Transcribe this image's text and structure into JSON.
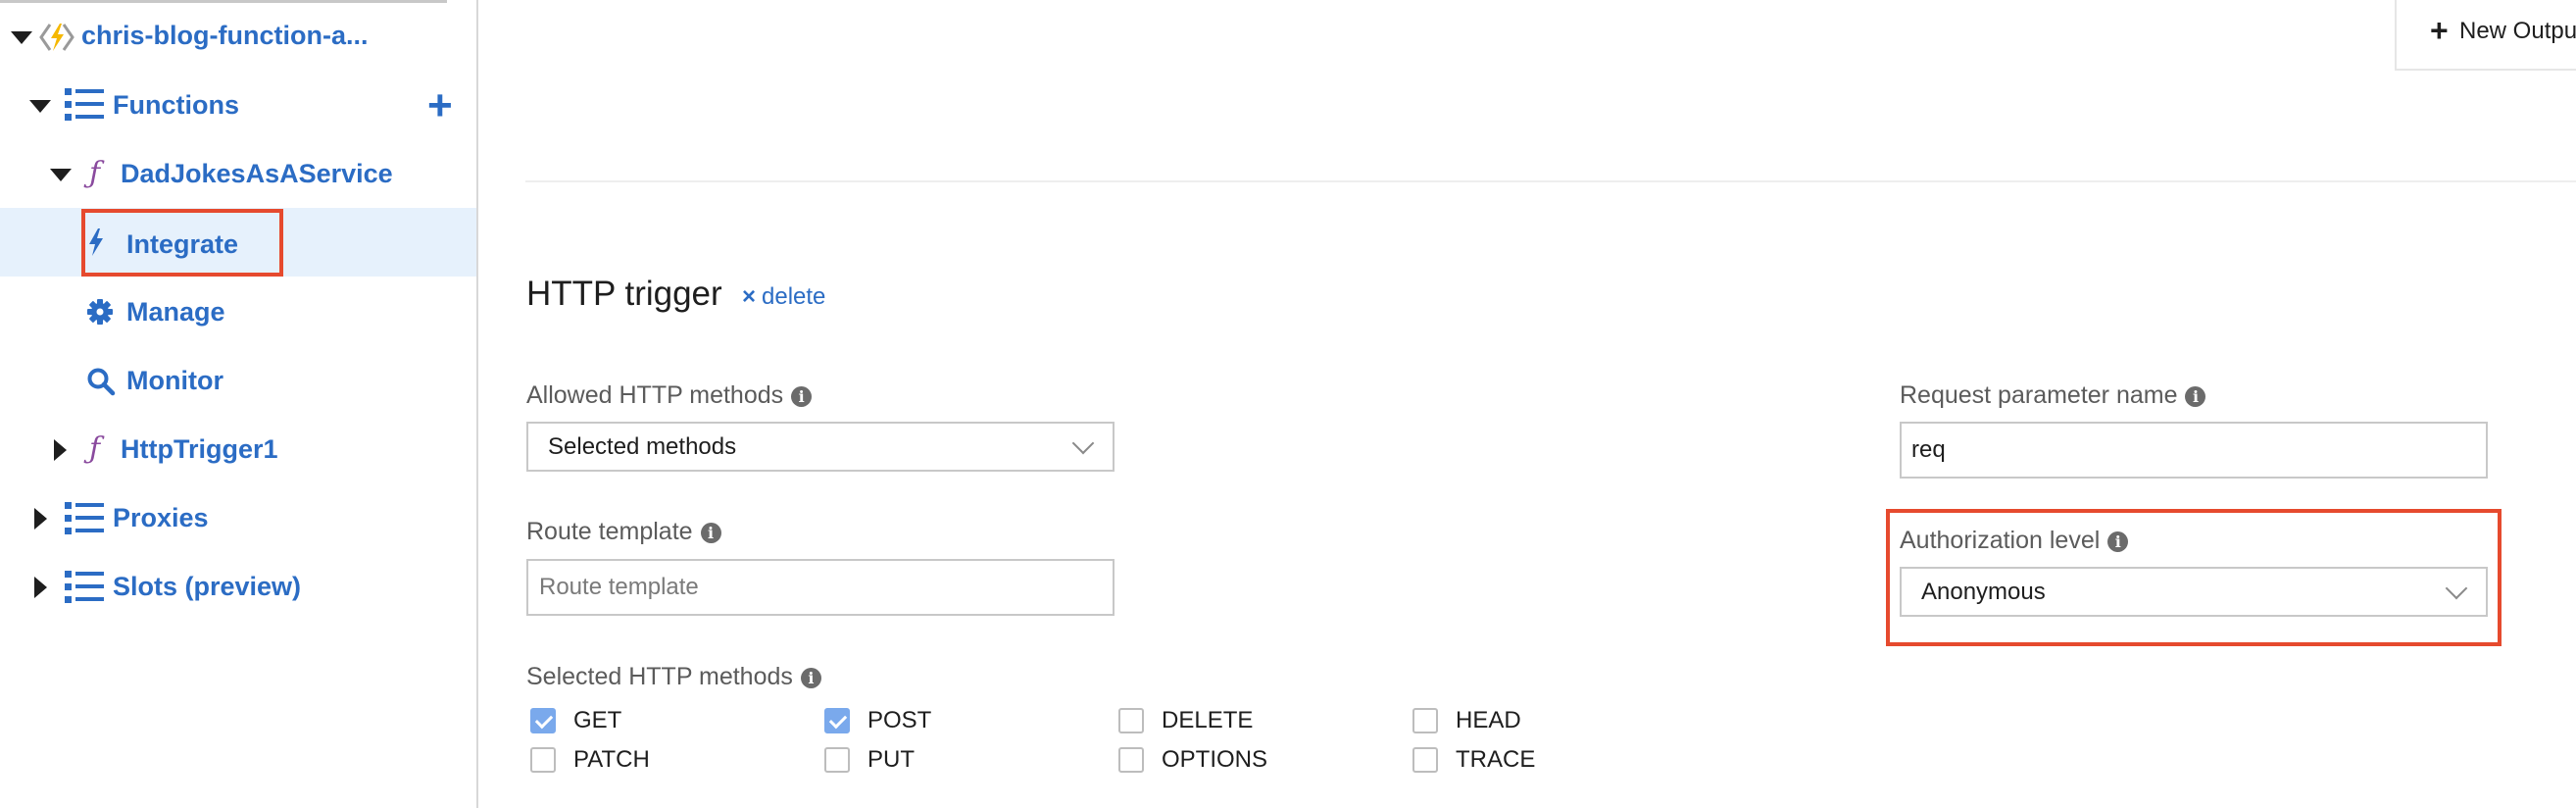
{
  "sidebar": {
    "app_name": "chris-blog-function-a...",
    "functions_label": "Functions",
    "function_name": "DadJokesAsAService",
    "function_icon": "ƒ",
    "integrate_label": "Integrate",
    "manage_label": "Manage",
    "monitor_label": "Monitor",
    "http_trigger_label": "HttpTrigger1",
    "proxies_label": "Proxies",
    "slots_label": "Slots (preview)",
    "add_symbol": "+",
    "selected_item": "Integrate"
  },
  "toolbar": {
    "new_output_label": "New Outpu",
    "new_output_icon": "+"
  },
  "trigger": {
    "title": "HTTP trigger",
    "delete_label": "delete",
    "delete_icon": "×"
  },
  "form": {
    "allowed_methods_label": "Allowed HTTP methods",
    "allowed_methods_value": "Selected methods",
    "route_template_label": "Route template",
    "route_template_placeholder": "Route template",
    "selected_methods_label": "Selected HTTP methods",
    "request_param_label": "Request parameter name",
    "request_param_value": "req",
    "auth_level_label": "Authorization level",
    "auth_level_value": "Anonymous",
    "info_icon": "i"
  },
  "methods": [
    {
      "name": "GET",
      "checked": true
    },
    {
      "name": "POST",
      "checked": true
    },
    {
      "name": "DELETE",
      "checked": false
    },
    {
      "name": "HEAD",
      "checked": false
    },
    {
      "name": "PATCH",
      "checked": false
    },
    {
      "name": "PUT",
      "checked": false
    },
    {
      "name": "OPTIONS",
      "checked": false
    },
    {
      "name": "TRACE",
      "checked": false
    }
  ],
  "colors": {
    "link_blue": "#2b6cc4",
    "highlight_red": "#e64a2e",
    "selected_bg": "#e6f1fc",
    "checkbox_blue": "#7aa9ec",
    "function_purple": "#8a4a9e"
  }
}
